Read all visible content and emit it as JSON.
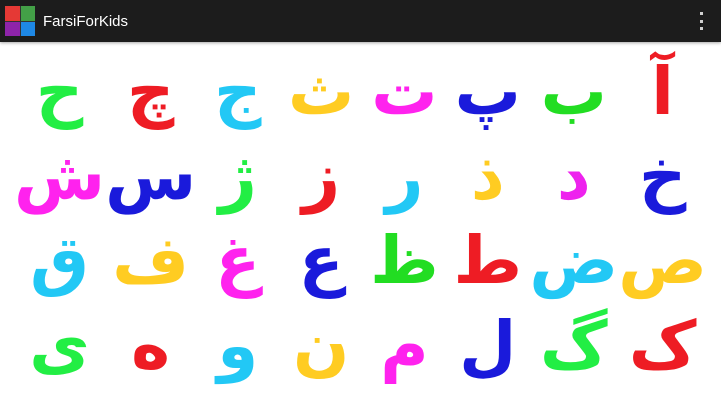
{
  "app": {
    "title": "FarsiForKids",
    "icon_colors": [
      "#e53935",
      "#43a047",
      "#8e24aa",
      "#1e88e5"
    ],
    "menu_icon": "overflow-menu-icon"
  },
  "letters": [
    {
      "char": "آ",
      "color": "#ee1c24"
    },
    {
      "char": "ب",
      "color": "#22dd22"
    },
    {
      "char": "پ",
      "color": "#1a1adb"
    },
    {
      "char": "ت",
      "color": "#ff22ee"
    },
    {
      "char": "ث",
      "color": "#ffcc22"
    },
    {
      "char": "ج",
      "color": "#22c8f5"
    },
    {
      "char": "چ",
      "color": "#ee1c24"
    },
    {
      "char": "ح",
      "color": "#22ee44"
    },
    {
      "char": "خ",
      "color": "#1a1adb"
    },
    {
      "char": "د",
      "color": "#ee22ee"
    },
    {
      "char": "ذ",
      "color": "#ffcc22"
    },
    {
      "char": "ر",
      "color": "#22c8f5"
    },
    {
      "char": "ز",
      "color": "#ee1c24"
    },
    {
      "char": "ژ",
      "color": "#22ee44"
    },
    {
      "char": "س",
      "color": "#1a1adb"
    },
    {
      "char": "ش",
      "color": "#ff22ee"
    },
    {
      "char": "ص",
      "color": "#ffcc22"
    },
    {
      "char": "ض",
      "color": "#22c8f5"
    },
    {
      "char": "ط",
      "color": "#ee1c24"
    },
    {
      "char": "ظ",
      "color": "#22dd22"
    },
    {
      "char": "ع",
      "color": "#1a1adb"
    },
    {
      "char": "غ",
      "color": "#ff22ee"
    },
    {
      "char": "ف",
      "color": "#ffcc22"
    },
    {
      "char": "ق",
      "color": "#22c8f5"
    },
    {
      "char": "ک",
      "color": "#ee1c24"
    },
    {
      "char": "گ",
      "color": "#22ee44"
    },
    {
      "char": "ل",
      "color": "#1a1adb"
    },
    {
      "char": "م",
      "color": "#ff22ee"
    },
    {
      "char": "ن",
      "color": "#ffcc22"
    },
    {
      "char": "و",
      "color": "#22c8f5"
    },
    {
      "char": "ه",
      "color": "#ee1c24"
    },
    {
      "char": "ی",
      "color": "#22ee44"
    }
  ]
}
